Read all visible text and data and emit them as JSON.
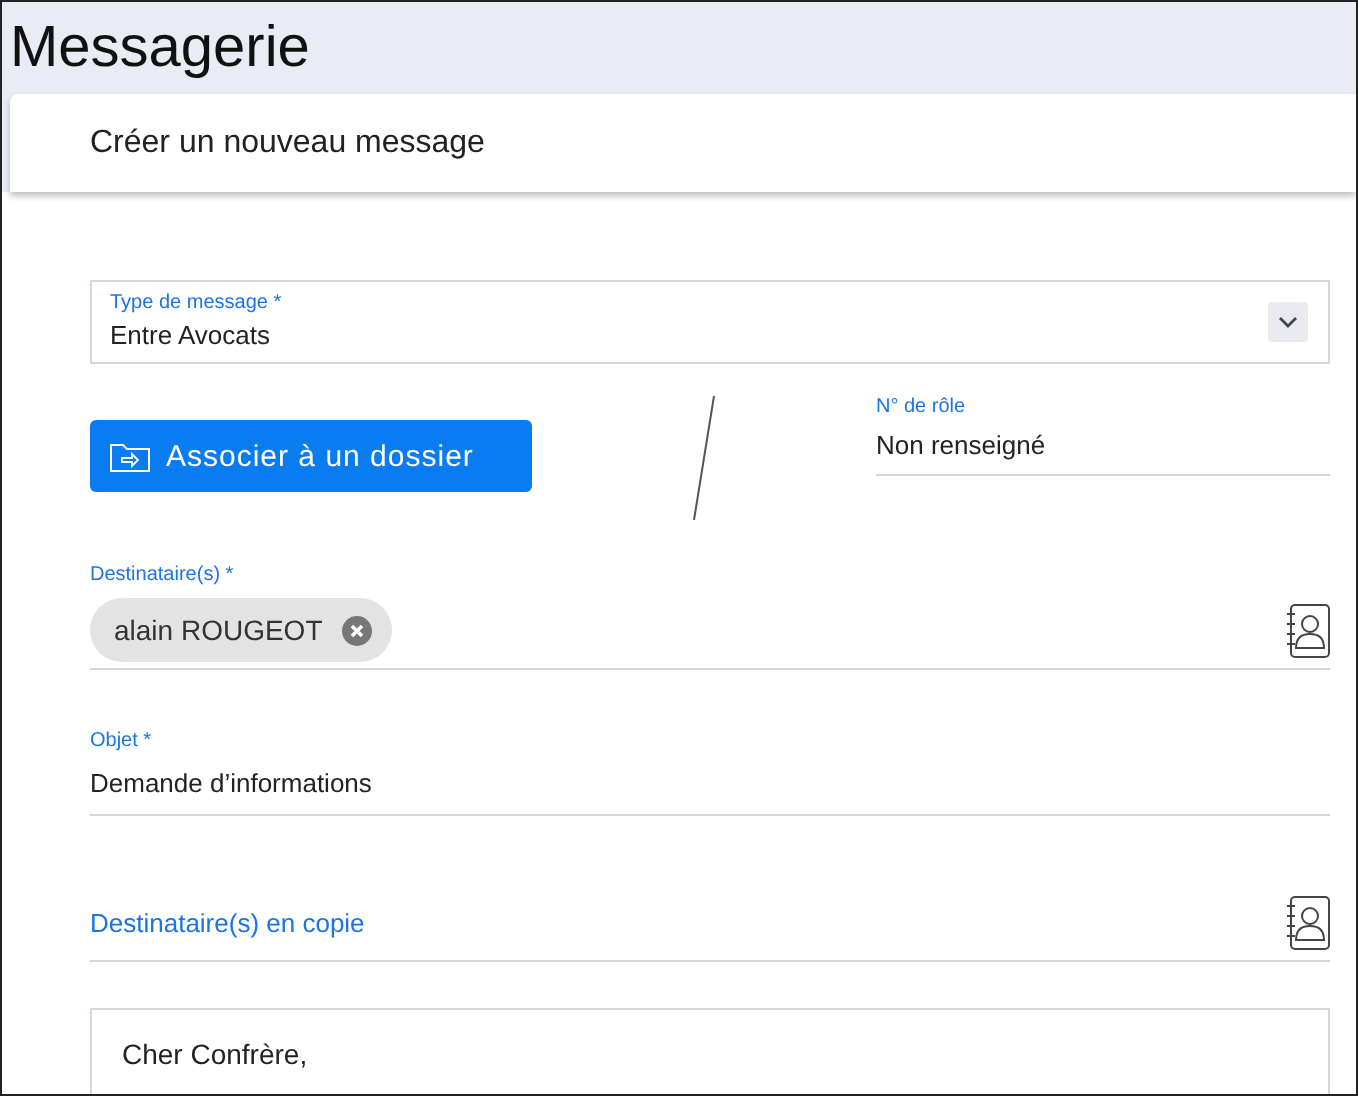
{
  "page_title": "Messagerie",
  "card_title": "Créer un nouveau message",
  "message_type": {
    "label": "Type de message *",
    "value": "Entre Avocats"
  },
  "associate_button": "Associer à un dossier",
  "role_number": {
    "label": "N° de rôle",
    "value": "Non renseigné"
  },
  "recipients": {
    "label": "Destinataire(s) *",
    "chips": [
      {
        "name": "alain ROUGEOT"
      }
    ]
  },
  "subject": {
    "label": "Objet *",
    "value": "Demande d’informations"
  },
  "cc": {
    "placeholder": "Destinataire(s) en copie"
  },
  "body": {
    "value": "Cher Confrère,"
  }
}
